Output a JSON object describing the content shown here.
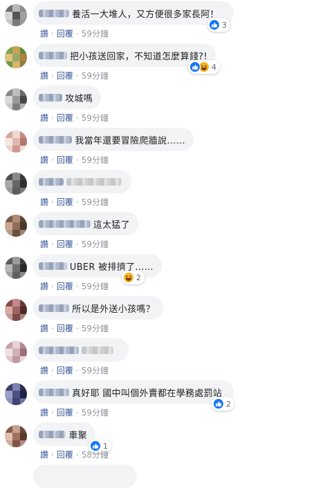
{
  "comments": [
    {
      "text": "養活一大堆人，又方便很多家長阿！",
      "reactions": [
        {
          "type": "like",
          "icon": "like-icon"
        }
      ],
      "reaction_count": "3",
      "actions": {
        "like": "讚",
        "reply": "回覆",
        "time": "59分鐘"
      }
    },
    {
      "text": "把小孩送回家，不知道怎麼算錢?!",
      "reactions": [
        {
          "type": "like",
          "icon": "like-icon"
        },
        {
          "type": "haha",
          "icon": "haha-icon"
        }
      ],
      "reaction_count": "4",
      "actions": {
        "like": "讚",
        "reply": "回覆",
        "time": "59分鐘"
      }
    },
    {
      "text": "攻城嗎",
      "reactions": [],
      "reaction_count": "",
      "actions": {
        "like": "讚",
        "reply": "回覆",
        "time": "59分鐘"
      }
    },
    {
      "text": "我當年還要冒險爬牆說……",
      "reactions": [],
      "reaction_count": "",
      "actions": {
        "like": "讚",
        "reply": "回覆",
        "time": "59分鐘"
      }
    },
    {
      "text": "",
      "reactions": [],
      "reaction_count": "",
      "actions": {
        "like": "讚",
        "reply": "回覆",
        "time": "59分鐘"
      }
    },
    {
      "text": "這太猛了",
      "reactions": [],
      "reaction_count": "",
      "actions": {
        "like": "讚",
        "reply": "回覆",
        "time": "59分鐘"
      }
    },
    {
      "text": "UBER 被排擠了……",
      "reactions": [
        {
          "type": "haha",
          "icon": "haha-icon"
        }
      ],
      "reaction_count": "2",
      "actions": {
        "like": "讚",
        "reply": "回覆",
        "time": "59分鐘"
      }
    },
    {
      "text": "所以是外送小孩嗎？",
      "reactions": [],
      "reaction_count": "",
      "actions": {
        "like": "讚",
        "reply": "回覆",
        "time": "59分鐘"
      }
    },
    {
      "text": "",
      "reactions": [],
      "reaction_count": "",
      "actions": {
        "like": "讚",
        "reply": "回覆",
        "time": "59分鐘"
      }
    },
    {
      "text": "真好耶 國中叫個外賣都在學務處罰站",
      "reactions": [
        {
          "type": "like",
          "icon": "like-icon"
        }
      ],
      "reaction_count": "2",
      "actions": {
        "like": "讚",
        "reply": "回覆",
        "time": "59分鐘"
      }
    },
    {
      "text": "車聚",
      "reactions": [
        {
          "type": "like",
          "icon": "like-icon"
        }
      ],
      "reaction_count": "1",
      "actions": {
        "like": "讚",
        "reply": "回覆",
        "time": "58分鐘"
      }
    }
  ],
  "colors": {
    "link": "#385898",
    "like": "#1877f2",
    "haha": "#f7b125",
    "bubble": "#f2f3f5"
  }
}
